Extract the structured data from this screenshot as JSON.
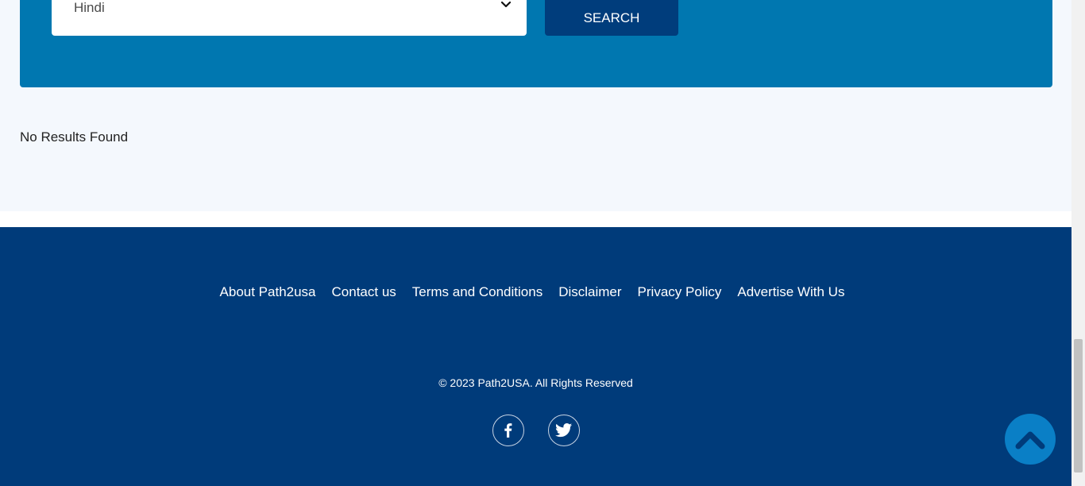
{
  "search": {
    "language_value": "Hindi",
    "search_label": "SEARCH"
  },
  "results": {
    "message": "No Results Found"
  },
  "footer": {
    "links": [
      {
        "label": "About Path2usa"
      },
      {
        "label": "Contact us"
      },
      {
        "label": "Terms and Conditions"
      },
      {
        "label": "Disclaimer"
      },
      {
        "label": "Privacy Policy"
      },
      {
        "label": "Advertise With Us"
      }
    ],
    "copyright": "© 2023 Path2USA. All Rights Reserved",
    "social": [
      {
        "icon": "facebook-icon"
      },
      {
        "icon": "twitter-icon"
      }
    ]
  },
  "colors": {
    "search_panel": "#0077b0",
    "search_button": "#003d7c",
    "footer_bg": "#003b7a",
    "back_to_top": "#0a7fc6",
    "content_bg": "#f4f8fd"
  }
}
